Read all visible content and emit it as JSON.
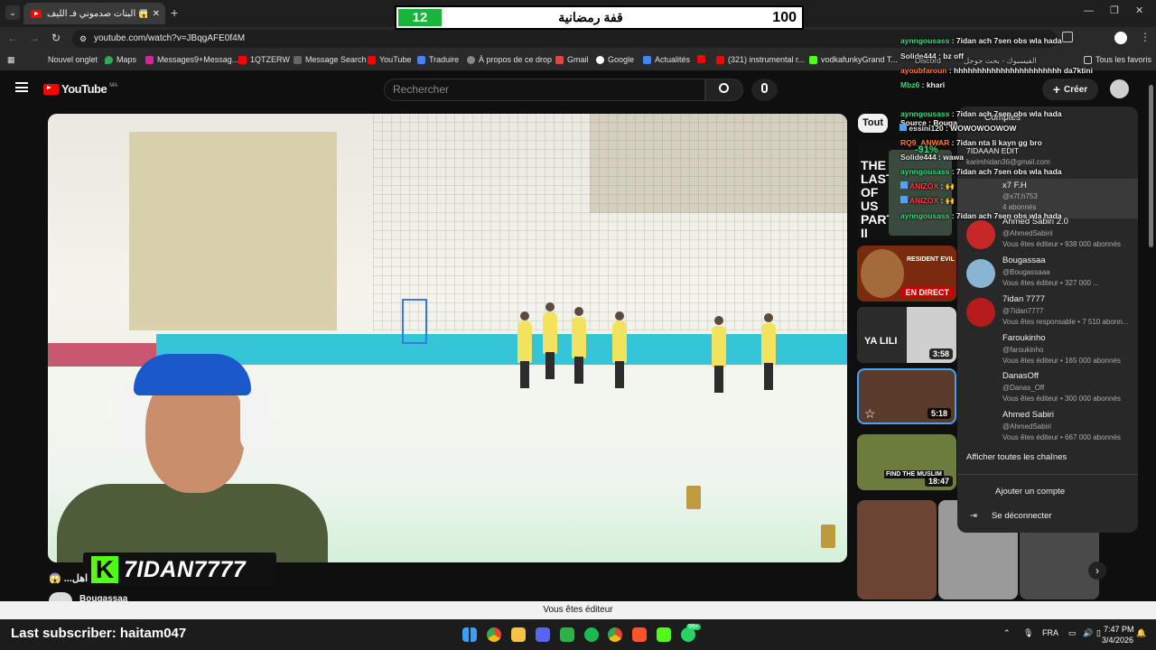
{
  "browser": {
    "tab_title": "البنات صدموني فـ الليف 😱 ...",
    "url": "youtube.com/watch?v=JBqgAFE0f4M",
    "bookmarks": [
      "Nouvel onglet",
      "Maps",
      "Messages9+Messag...",
      "1QTZERW",
      "Message Search",
      "YouTube",
      "Traduire",
      "À propos de ce drop",
      "Gmail",
      "Google",
      "Actualités",
      "(321) instrumental r...",
      "vodkafunkyGrand T...",
      "Tous les favoris"
    ]
  },
  "score_overlay": {
    "left_value": "12",
    "title": "قفة رمضانية",
    "right_value": "100"
  },
  "youtube": {
    "logo": "YouTube",
    "logo_country": "MA",
    "search_placeholder": "Rechercher",
    "create_label": "Créer",
    "filter_chip": "Tout",
    "video_caption": "😱 ...اهل",
    "channel_name": "Bougassaa",
    "streamer_badge": "7IDAN7777",
    "editor_notice": "Vous êtes éditeur"
  },
  "thumbnails": [
    {
      "title": "THE LAST OF US PART II PC",
      "badge": ""
    },
    {
      "title": "RESIDENT EVIL",
      "badge": "EN DIRECT"
    },
    {
      "title": "YA LILI",
      "badge": "3:58"
    },
    {
      "title": "",
      "badge": "5:18"
    },
    {
      "title": "FIND THE MUSLIM",
      "badge": "18:47"
    }
  ],
  "accounts_menu": {
    "header": "Comptes",
    "current": {
      "name": "7IDAAAN EDIT",
      "email": "karimhidan36@gmail.com"
    },
    "items": [
      {
        "name": "x7 F.H",
        "handle": "@x7f.h753",
        "role": "4 abonnés"
      },
      {
        "name": "Ahmed Sabiri 2.0",
        "handle": "@AhmedSabirii",
        "role": "Vous êtes éditeur • 938 000 abonnés"
      },
      {
        "name": "Bougassaa",
        "handle": "@Bougassaaa",
        "role": "Vous êtes éditeur • 327 000 ..."
      },
      {
        "name": "7idan 7777",
        "handle": "@7idan7777",
        "role": "Vous êtes responsable • 7 510 abonn..."
      },
      {
        "name": "Faroukinho",
        "handle": "@faroukinho",
        "role": "Vous êtes éditeur • 165 000 abonnés"
      },
      {
        "name": "DanasOff",
        "handle": "@Danas_Off",
        "role": "Vous êtes éditeur • 300 000 abonnés"
      },
      {
        "name": "Ahmed Sabiri",
        "handle": "@AhmedSabiri",
        "role": "Vous êtes éditeur • 667 000 abonnés"
      }
    ],
    "show_all": "Afficher toutes les chaînes",
    "add_account": "Ajouter un compte",
    "sign_out": "Se déconnecter"
  },
  "chat": [
    {
      "user": "aynngousass",
      "msg": "7idan ach 7sen obs wla hada",
      "color": "#35e07a"
    },
    {
      "user": "Solide444",
      "msg": "bz off",
      "color": "#e5e5e5"
    },
    {
      "user": "ayoubfaroun",
      "msg": "hhhhhhhhhhhhhhhhhhhhhhh da7ktini",
      "color": "#ff7a3a"
    },
    {
      "user": "Mbz6",
      "msg": "khari",
      "color": "#35e07a"
    },
    {
      "user": "aynngousass",
      "msg": "7idan ach 7sen obs wla hada",
      "color": "#35e07a"
    },
    {
      "user": "essini120",
      "msg": "WOWOWOOWOW",
      "color": "#e5e5e5"
    },
    {
      "user": "RQ9_ANWAR",
      "msg": "7idan nta li kayn gg bro",
      "color": "#ff7a3a"
    },
    {
      "user": "Solide444",
      "msg": "wawa",
      "color": "#e5e5e5"
    },
    {
      "user": "aynngousass",
      "msg": "7idan ach 7sen obs wla hada",
      "color": "#35e07a"
    },
    {
      "user": "ANIZOX",
      "msg": "🙌",
      "color": "#ff4040"
    },
    {
      "user": "ANIZOX",
      "msg": "🙌",
      "color": "#ff4040"
    },
    {
      "user": "aynngousass",
      "msg": "7idan ach 7sen obs wla hada",
      "color": "#35e07a"
    }
  ],
  "overlay_snippets": {
    "source": "Source : Bouga",
    "discord": "Discord",
    "percent": "-91%",
    "search_hint": "الفيسبوك - بحث جوجل"
  },
  "taskbar": {
    "last_subscriber": "Last subscriber: haitam047",
    "lang": "FRA",
    "time": "7:47 PM",
    "date": "3/4/2026",
    "badge_count": "99+"
  }
}
